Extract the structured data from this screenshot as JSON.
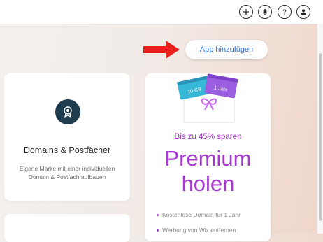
{
  "header": {
    "icons": [
      "add-icon",
      "notifications-bell-icon",
      "help-question-icon",
      "account-user-icon"
    ]
  },
  "toolbar": {
    "add_app_label": "App hinzufügen"
  },
  "domains_card": {
    "icon": "globe-badge-icon",
    "title": "Domains & Postfächer",
    "description": "Eigene Marke mit einer individuellen Domain & Postfach aufbauen"
  },
  "premium_card": {
    "ticket_1": "10 GB",
    "ticket_2": "1 Jahr",
    "promo": "Bis zu 45% sparen",
    "title_line1": "Premium",
    "title_line2": "holen",
    "features": [
      "Kostenlose Domain für 1 Jahr",
      "Werbung von Wix entfernen"
    ]
  },
  "colors": {
    "accent_blue": "#2f6fe0",
    "premium_purple": "#a43bd0",
    "arrow_red": "#e8211d",
    "icon_navy": "#1f3d4f"
  }
}
